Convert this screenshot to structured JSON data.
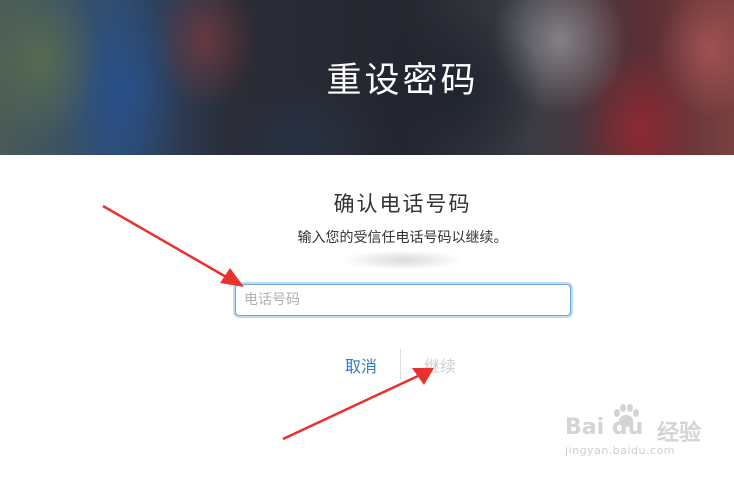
{
  "hero": {
    "title": "重设密码"
  },
  "form": {
    "subtitle": "确认电话号码",
    "instruction": "输入您的受信任电话号码以继续。",
    "phone_input": {
      "placeholder": "电话号码",
      "value": ""
    },
    "cancel_label": "取消",
    "continue_label": "继续"
  },
  "colors": {
    "link_blue": "#2d7bd0",
    "disabled_gray": "#cfcfcf",
    "input_focus_border": "#6aa6dd",
    "annotation_arrow": "#e8322e"
  },
  "watermark": {
    "logo": "Bai du",
    "text": "经验",
    "url": "jingyan.baidu.com"
  }
}
